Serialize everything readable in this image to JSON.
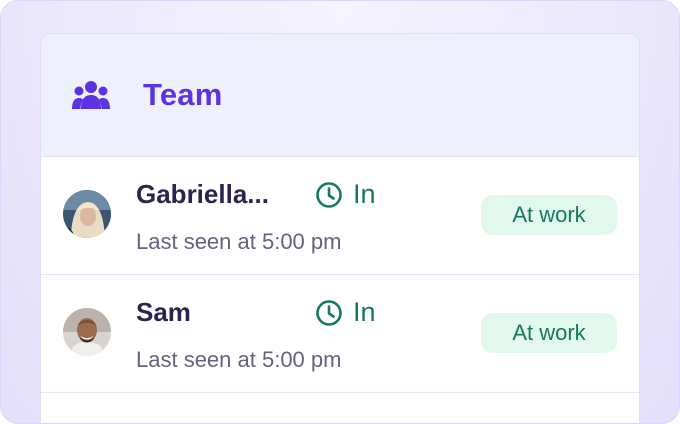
{
  "header": {
    "icon": "team-icon",
    "title": "Team"
  },
  "members": [
    {
      "name": "Gabriella...",
      "status_label": "In",
      "status_icon": "clock-icon",
      "last_seen": "Last seen at 5:00 pm",
      "badge": "At work",
      "avatar": "avatar-photo-woman-blonde"
    },
    {
      "name": "Sam",
      "status_label": "In",
      "status_icon": "clock-icon",
      "last_seen": "Last seen at 5:00 pm",
      "badge": "At work",
      "avatar": "avatar-photo-man-bald"
    }
  ],
  "colors": {
    "accent": "#5a34e0",
    "status_green": "#137a5a",
    "badge_bg": "#e2f8ed",
    "header_bg": "#eff0fd"
  }
}
